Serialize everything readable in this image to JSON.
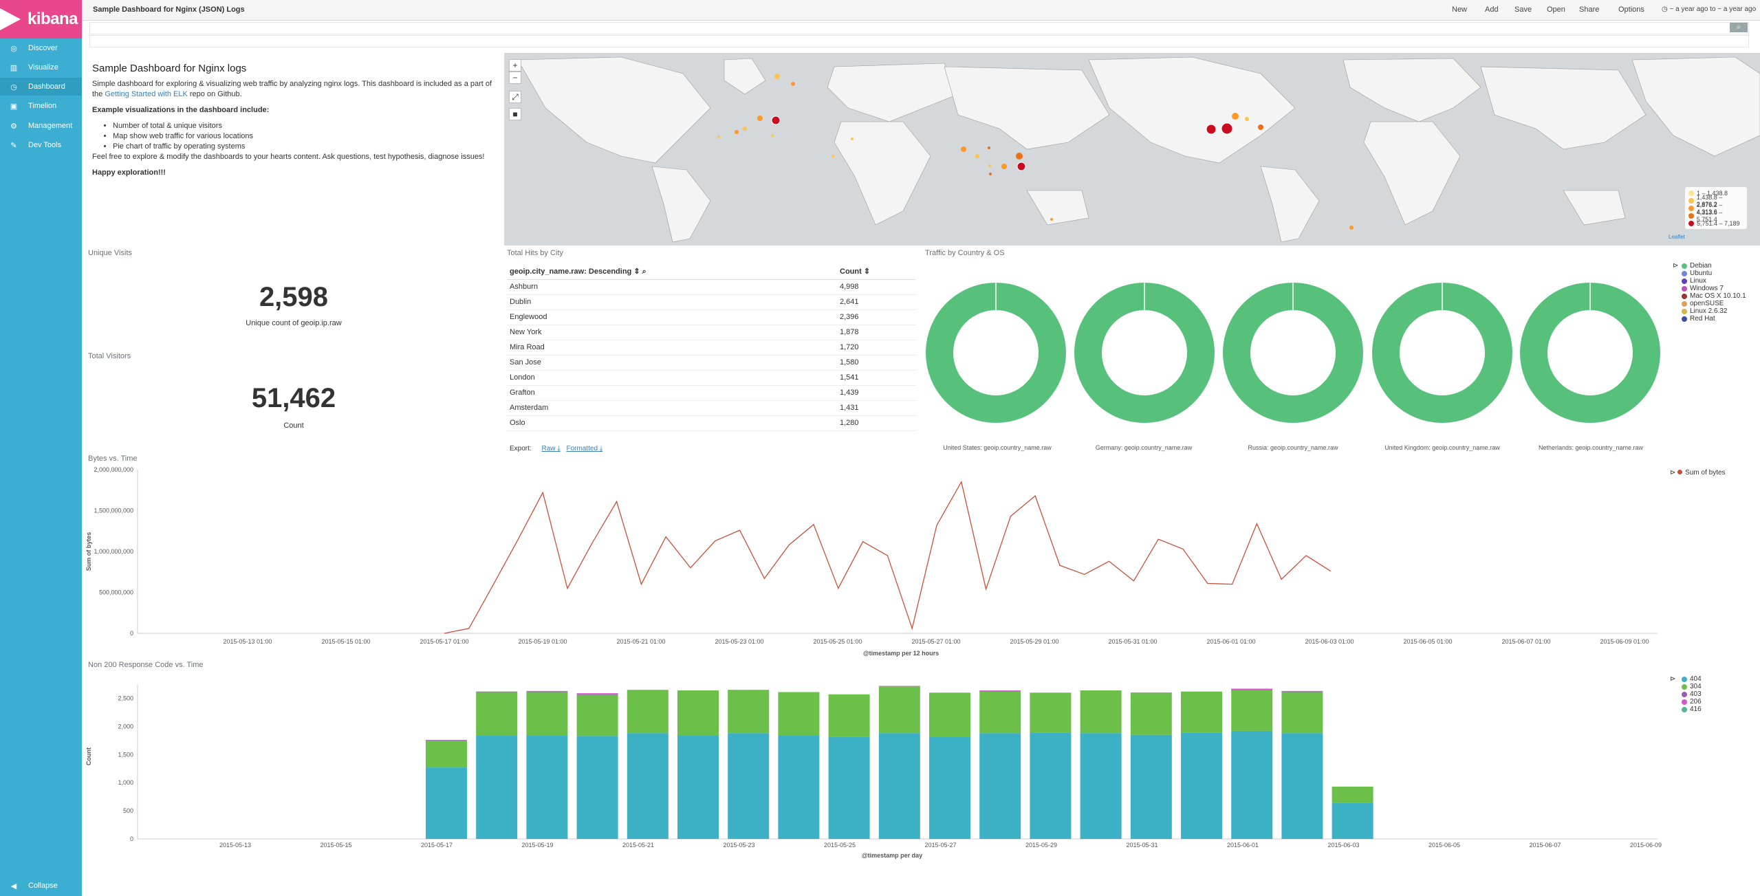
{
  "app": {
    "logo_text": "kibana",
    "dashboard_title": "Sample Dashboard for Nginx (JSON) Logs"
  },
  "sidebar": {
    "items": [
      {
        "label": "Discover",
        "icon": "compass-icon"
      },
      {
        "label": "Visualize",
        "icon": "bar-chart-icon"
      },
      {
        "label": "Dashboard",
        "icon": "dashboard-icon"
      },
      {
        "label": "Timelion",
        "icon": "timelion-icon"
      },
      {
        "label": "Management",
        "icon": "gear-icon"
      },
      {
        "label": "Dev Tools",
        "icon": "wrench-icon"
      }
    ],
    "collapse_label": "Collapse"
  },
  "toolbar": {
    "new": "New",
    "add": "Add",
    "save": "Save",
    "open": "Open",
    "share": "Share",
    "options": "Options",
    "time_range": "~ a year ago to ~ a year ago"
  },
  "markdown": {
    "heading": "Sample Dashboard for Nginx logs",
    "intro_1": "Simple dashboard for exploring & visualizing web traffic by analyzing nginx logs. This dashboard is included as a part of the",
    "link": "Getting Started with ELK",
    "intro_2": "repo on Github.",
    "examples_heading": "Example visualizations in the dashboard include:",
    "examples": [
      "Number of total & unique visitors",
      "Map show web traffic for various locations",
      "Pie chart of traffic by operating systems"
    ],
    "outro": "Feel free to explore & modify the dashboards to your hearts content. Ask questions, test hypothesis, diagnose issues!",
    "sign_off": "Happy exploration!!!"
  },
  "map": {
    "legend": [
      "1 – 1,438.8",
      "1,438.8 – 2,876.2",
      "2,876.2 – 4,313.6",
      "4,313.6 – 5,751.4",
      "5,751.4 – 7,189"
    ],
    "legend_colors": [
      "#fee391",
      "#fec44f",
      "#fe9929",
      "#ec7014",
      "#cc0b1e"
    ],
    "attribution": "Leaflet"
  },
  "unique_visits": {
    "title": "Unique Visits",
    "value": "2,598",
    "label": "Unique count of geoip.ip.raw"
  },
  "total_visitors": {
    "title": "Total Visitors",
    "value": "51,462",
    "label": "Count"
  },
  "city_table": {
    "title": "Total Hits by City",
    "col1": "geoip.city_name.raw: Descending",
    "col2": "Count",
    "rows": [
      {
        "city": "Ashburn",
        "count": "4,998"
      },
      {
        "city": "Dublin",
        "count": "2,641"
      },
      {
        "city": "Englewood",
        "count": "2,396"
      },
      {
        "city": "New York",
        "count": "1,878"
      },
      {
        "city": "Mira Road",
        "count": "1,720"
      },
      {
        "city": "San Jose",
        "count": "1,580"
      },
      {
        "city": "London",
        "count": "1,541"
      },
      {
        "city": "Grafton",
        "count": "1,439"
      },
      {
        "city": "Amsterdam",
        "count": "1,431"
      },
      {
        "city": "Oslo",
        "count": "1,280"
      }
    ],
    "export_label": "Export:",
    "raw_label": "Raw",
    "formatted_label": "Formatted"
  },
  "os_traffic": {
    "title": "Traffic by Country & OS",
    "pies": [
      "United States: geoip.country_name.raw",
      "Germany: geoip.country_name.raw",
      "Russia: geoip.country_name.raw",
      "United Kingdom: geoip.country_name.raw",
      "Netherlands: geoip.country_name.raw"
    ],
    "legend": [
      {
        "name": "Debian",
        "color": "#57c17b"
      },
      {
        "name": "Ubuntu",
        "color": "#6f87d8"
      },
      {
        "name": "Linux",
        "color": "#663db8"
      },
      {
        "name": "Windows 7",
        "color": "#bc52bc"
      },
      {
        "name": "Mac OS X 10.10.1",
        "color": "#9e3533"
      },
      {
        "name": "openSUSE",
        "color": "#daa05d"
      },
      {
        "name": "Linux 2.6.32",
        "color": "#d3b545"
      },
      {
        "name": "Red Hat",
        "color": "#3a4f9e"
      }
    ]
  },
  "chart_data": [
    {
      "type": "line",
      "title": "Bytes vs. Time",
      "xlabel": "@timestamp per 12 hours",
      "ylabel": "Sum of bytes",
      "ylim": [
        0,
        2000000000
      ],
      "yticks": [
        "0",
        "500,000,000",
        "1,000,000,000",
        "1,500,000,000",
        "2,000,000,000"
      ],
      "xticks": [
        "2015-05-13 01:00",
        "2015-05-15 01:00",
        "2015-05-17 01:00",
        "2015-05-19 01:00",
        "2015-05-21 01:00",
        "2015-05-23 01:00",
        "2015-05-25 01:00",
        "2015-05-27 01:00",
        "2015-05-29 01:00",
        "2015-05-31 01:00",
        "2015-06-01 01:00",
        "2015-06-03 01:00",
        "2015-06-05 01:00",
        "2015-06-07 01:00",
        "2015-06-09 01:00"
      ],
      "series": [
        {
          "name": "Sum of bytes",
          "color": "#c8503a",
          "values": [
            0,
            60000000,
            600000000,
            1150000000,
            1720000000,
            550000000,
            1100000000,
            1610000000,
            600000000,
            1180000000,
            800000000,
            1130000000,
            1260000000,
            670000000,
            1080000000,
            1330000000,
            550000000,
            1120000000,
            950000000,
            60000000,
            1320000000,
            1850000000,
            540000000,
            1430000000,
            1680000000,
            830000000,
            720000000,
            880000000,
            640000000,
            1150000000,
            1030000000,
            610000000,
            600000000,
            1340000000,
            660000000,
            950000000,
            760000000
          ]
        }
      ]
    },
    {
      "type": "bar",
      "title": "Non 200 Response Code vs. Time",
      "xlabel": "@timestamp per day",
      "ylabel": "Count",
      "ylim": [
        0,
        2750
      ],
      "yticks": [
        "0",
        "500",
        "1,000",
        "1,500",
        "2,000",
        "2,500"
      ],
      "xticks": [
        "2015-05-13",
        "2015-05-15",
        "2015-05-17",
        "2015-05-19",
        "2015-05-21",
        "2015-05-23",
        "2015-05-25",
        "2015-05-27",
        "2015-05-29",
        "2015-05-31",
        "2015-06-01",
        "2015-06-03",
        "2015-06-05",
        "2015-06-07",
        "2015-06-09"
      ],
      "categories": [
        "2015-05-17",
        "2015-05-18",
        "2015-05-19",
        "2015-05-20",
        "2015-05-21",
        "2015-05-22",
        "2015-05-23",
        "2015-05-24",
        "2015-05-25",
        "2015-05-26",
        "2015-05-27",
        "2015-05-28",
        "2015-05-29",
        "2015-05-30",
        "2015-05-31",
        "2015-06-01",
        "2015-06-02",
        "2015-06-03",
        "2015-06-04"
      ],
      "series": [
        {
          "name": "404",
          "color": "#3cb0c4",
          "values": [
            1270,
            1840,
            1840,
            1830,
            1880,
            1840,
            1880,
            1840,
            1810,
            1880,
            1820,
            1880,
            1890,
            1880,
            1850,
            1890,
            1920,
            1880,
            640
          ]
        },
        {
          "name": "304",
          "color": "#6cc04a",
          "values": [
            480,
            770,
            770,
            730,
            770,
            800,
            770,
            770,
            760,
            830,
            780,
            740,
            710,
            760,
            740,
            730,
            720,
            730,
            290
          ]
        },
        {
          "name": "403",
          "color": "#9b59b6",
          "values": [
            10,
            10,
            10,
            10,
            0,
            0,
            0,
            0,
            0,
            0,
            0,
            10,
            0,
            0,
            10,
            0,
            10,
            10,
            0
          ]
        },
        {
          "name": "206",
          "color": "#d257c7",
          "values": [
            0,
            0,
            10,
            20,
            0,
            0,
            0,
            0,
            0,
            10,
            0,
            10,
            0,
            0,
            0,
            0,
            20,
            10,
            0
          ]
        },
        {
          "name": "416",
          "color": "#54b399",
          "values": [
            0,
            0,
            0,
            0,
            0,
            0,
            0,
            0,
            0,
            0,
            0,
            0,
            0,
            0,
            0,
            0,
            0,
            0,
            0
          ]
        }
      ]
    }
  ]
}
